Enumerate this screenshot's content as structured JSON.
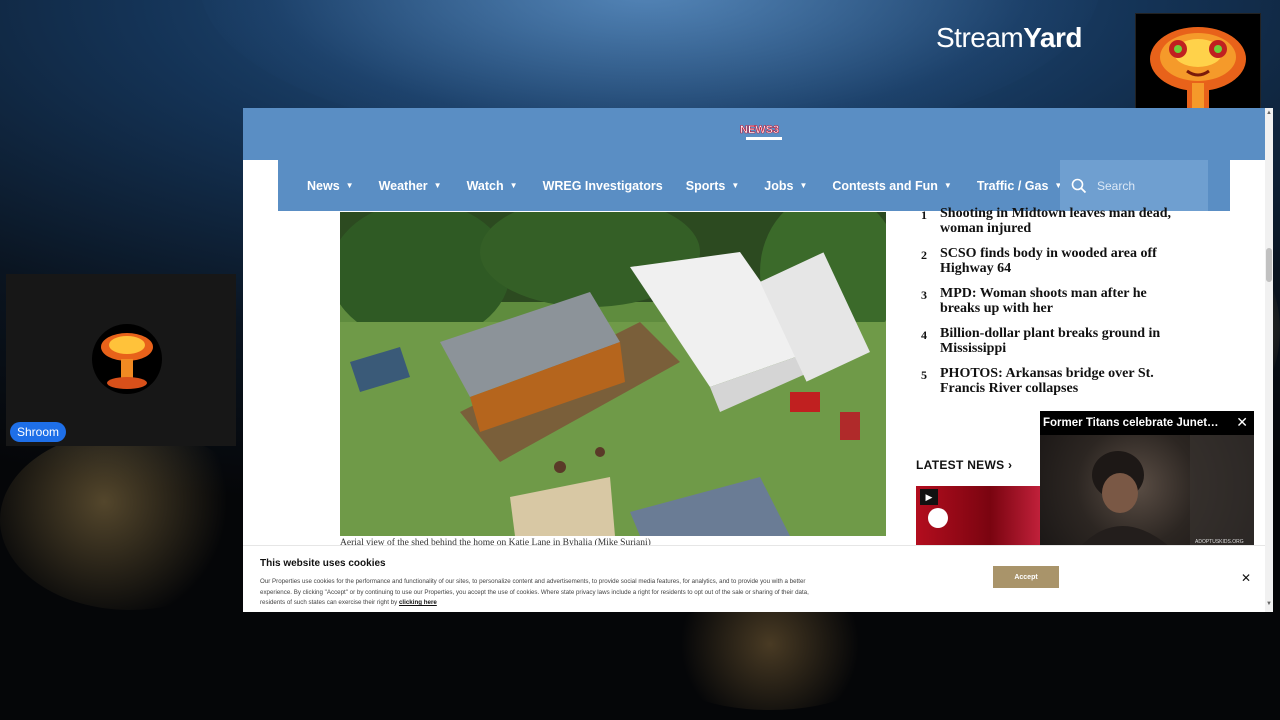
{
  "overlay": {
    "brand_light": "Stream",
    "brand_bold": "Yard",
    "participant_name": "Shroom"
  },
  "site": {
    "logo_text": "NEWS3",
    "nav": [
      {
        "label": "News",
        "caret": true
      },
      {
        "label": "Weather",
        "caret": true
      },
      {
        "label": "Watch",
        "caret": true
      },
      {
        "label": "WREG Investigators",
        "caret": false
      },
      {
        "label": "Sports",
        "caret": true
      },
      {
        "label": "Jobs",
        "caret": true
      },
      {
        "label": "Contests and Fun",
        "caret": true
      },
      {
        "label": "Traffic / Gas",
        "caret": true
      }
    ],
    "search_placeholder": "Search"
  },
  "article": {
    "caption": "Aerial view of the shed behind the home on Katie Lane in Byhalia (Mike Suriani)"
  },
  "trending": [
    {
      "num": "1",
      "text": "Shooting in Midtown leaves man dead, woman injured"
    },
    {
      "num": "2",
      "text": "SCSO finds body in wooded area off Highway 64"
    },
    {
      "num": "3",
      "text": "MPD: Woman shoots man after he breaks up with her"
    },
    {
      "num": "4",
      "text": "Billion-dollar plant breaks ground in Mississippi"
    },
    {
      "num": "5",
      "text": "PHOTOS: Arkansas bridge over St. Francis River collapses"
    }
  ],
  "latest_news_label": "LATEST NEWS ›",
  "video": {
    "title": "Former Titans celebrate Juneteenth",
    "watermark": "ADOPTUSKIDS.ORG"
  },
  "cookie": {
    "title": "This website uses cookies",
    "body": "Our Properties use cookies for the performance and functionality of our sites, to personalize content and advertisements, to provide social media features, for analytics, and to provide you with a better experience. By clicking \"Accept\" or by continuing to use our Properties, you accept the use of cookies. Where state privacy laws include a right for residents to opt out of the sale or sharing of their data, residents of such states can exercise their right by",
    "link": "clicking here",
    "accept_label": "Accept"
  },
  "colors": {
    "nav_bg": "#5a8ec4",
    "accept_bg": "#a9946a",
    "badge_bg": "#1e6fe8"
  }
}
